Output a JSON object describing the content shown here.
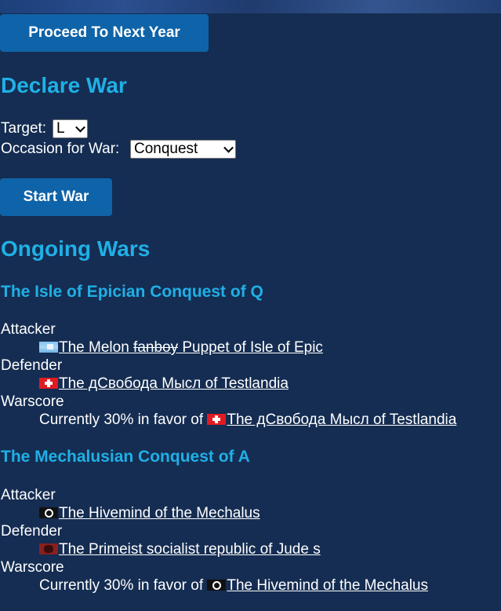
{
  "buttons": {
    "proceed": "Proceed To Next Year",
    "start_war": "Start War"
  },
  "declare_war": {
    "heading": "Declare War",
    "target_label": "Target:",
    "target_value": "L",
    "occasion_label": "Occasion for War:",
    "occasion_value": "Conquest"
  },
  "ongoing": {
    "heading": "Ongoing Wars",
    "wars": [
      {
        "title": "The Isle of Epician Conquest of Q",
        "attacker_label": "Attacker",
        "attacker_prefix": "The Melon ",
        "attacker_struck": "fanboy",
        "attacker_suffix": " Puppet of Isle of Epic",
        "defender_label": "Defender",
        "defender": "The дСвобода Мысл of Testlandia",
        "warscore_label": "Warscore",
        "warscore_text": "Currently 30% in favor of ",
        "warscore_nation": "The дСвобода Мысл of Testlandia"
      },
      {
        "title": "The Mechalusian Conquest of A",
        "attacker_label": "Attacker",
        "attacker": "The Hivemind of the Mechalus",
        "defender_label": "Defender",
        "defender": "The Primeist socialist republic of Jude s",
        "warscore_label": "Warscore",
        "warscore_text": "Currently 30% in favor of ",
        "warscore_nation": "The Hivemind of the Mechalus"
      }
    ]
  },
  "colors": {
    "background": "#152d52",
    "heading": "#1fb0e6",
    "button": "#0f63a8"
  }
}
